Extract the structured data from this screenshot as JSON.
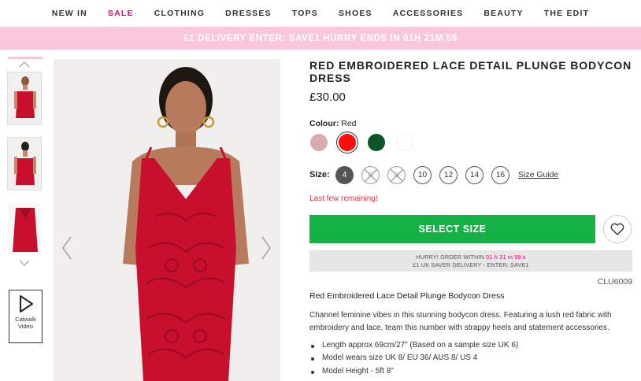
{
  "nav": {
    "items": [
      "NEW IN",
      "SALE",
      "CLOTHING",
      "DRESSES",
      "TOPS",
      "SHOES",
      "ACCESSORIES",
      "BEAUTY",
      "THE EDIT"
    ]
  },
  "promo": {
    "text": "£1 DELIVERY ENTER: SAVE1 HURRY ENDS IN 01H 21M 59"
  },
  "gallery": {
    "catwalk_label_1": "Catwalk",
    "catwalk_label_2": "Video"
  },
  "product": {
    "title": "RED EMBROIDERED LACE DETAIL PLUNGE BODYCON DRESS",
    "price": "£30.00",
    "colour_label": "Colour:",
    "colour_value": "Red",
    "swatches": [
      {
        "name": "Pink",
        "color": "#d9aab2",
        "selected": false
      },
      {
        "name": "Red",
        "color": "#ff0d0d",
        "selected": true
      },
      {
        "name": "Green",
        "color": "#0d5428",
        "selected": false
      },
      {
        "name": "White",
        "color": "#ffffff",
        "selected": false
      }
    ],
    "size_label": "Size:",
    "sizes": [
      {
        "label": "4",
        "state": "selected"
      },
      {
        "label": "6",
        "state": "oos"
      },
      {
        "label": "8",
        "state": "oos"
      },
      {
        "label": "10",
        "state": "available"
      },
      {
        "label": "12",
        "state": "available"
      },
      {
        "label": "14",
        "state": "available"
      },
      {
        "label": "16",
        "state": "available"
      }
    ],
    "size_guide": "Size Guide",
    "stock_note": "Last few remaining!",
    "select_button": "SELECT SIZE",
    "hurry_line1_a": "HURRY! ORDER WITHIN",
    "hurry_time": "01 h   21 m   59 s",
    "hurry_line2": "£1 UK SAVER DELIVERY - ENTER: SAVE1",
    "code": "CLU6009",
    "desc_title": "Red Embroidered Lace Detail Plunge Bodycon Dress",
    "desc": "Channel feminine vibes in this stunning bodycon dress. Featuring a lush red fabric with embroidery and lace, team this number with strappy heels and statement accessories.",
    "bullets": [
      "Length approx 69cm/27\" (Based on a sample size UK 6)",
      "Model wears size UK 8/ EU 36/ AUS 8/ US 4",
      "Model Height - 5ft 8\""
    ]
  },
  "colors": {
    "accent_pink": "#e5006d",
    "promo_bg": "#f9c6de",
    "button_green": "#14b246",
    "dress_red": "#c8102e"
  }
}
